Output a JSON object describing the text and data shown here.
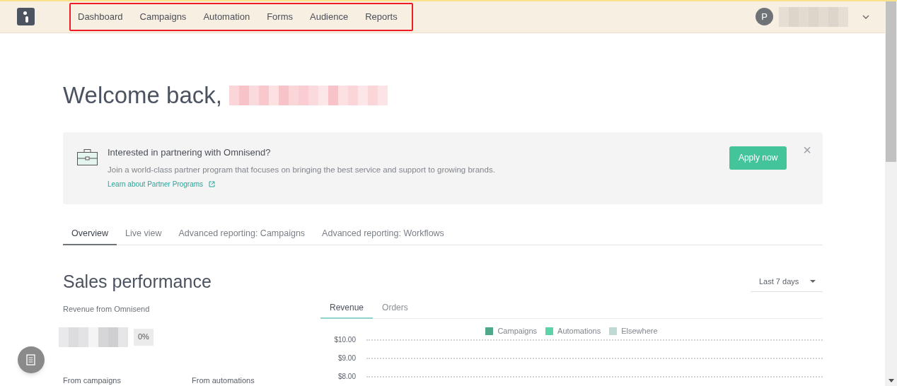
{
  "nav": {
    "items": [
      {
        "label": "Dashboard",
        "selected": false
      },
      {
        "label": "Campaigns",
        "selected": false
      },
      {
        "label": "Automation",
        "selected": false
      },
      {
        "label": "Forms",
        "selected": false
      },
      {
        "label": "Audience",
        "selected": false
      },
      {
        "label": "Reports",
        "selected": false
      }
    ],
    "highlighted": true
  },
  "user": {
    "initial": "P"
  },
  "welcome": {
    "title": "Welcome back,"
  },
  "banner": {
    "title": "Interested in partnering with Omnisend?",
    "text": "Join a world-class partner program that focuses on bringing the best service and support to growing brands.",
    "link": "Learn about Partner Programs",
    "button": "Apply now",
    "close": "×"
  },
  "tabs": [
    {
      "label": "Overview",
      "selected": true
    },
    {
      "label": "Live view",
      "selected": false
    },
    {
      "label": "Advanced reporting: Campaigns",
      "selected": false
    },
    {
      "label": "Advanced reporting: Workflows",
      "selected": false
    }
  ],
  "sales": {
    "title": "Sales performance",
    "period": "Last 7 days",
    "revenue_label": "Revenue from Omnisend",
    "change": "0%",
    "from_campaigns": "From campaigns",
    "from_automations": "From automations",
    "chart_tabs": [
      {
        "label": "Revenue",
        "selected": true
      },
      {
        "label": "Orders",
        "selected": false
      }
    ],
    "chart_data": {
      "type": "bar",
      "ylim": [
        8,
        10
      ],
      "yticks": [
        {
          "value": 10,
          "label": "$10.00"
        },
        {
          "value": 9,
          "label": "$9.00"
        },
        {
          "value": 8,
          "label": "$8.00"
        }
      ],
      "series": [
        {
          "name": "Campaigns",
          "color": "#4fa88a"
        },
        {
          "name": "Automations",
          "color": "#5dd3aa"
        },
        {
          "name": "Elsewhere",
          "color": "#bfdad6"
        }
      ]
    }
  }
}
